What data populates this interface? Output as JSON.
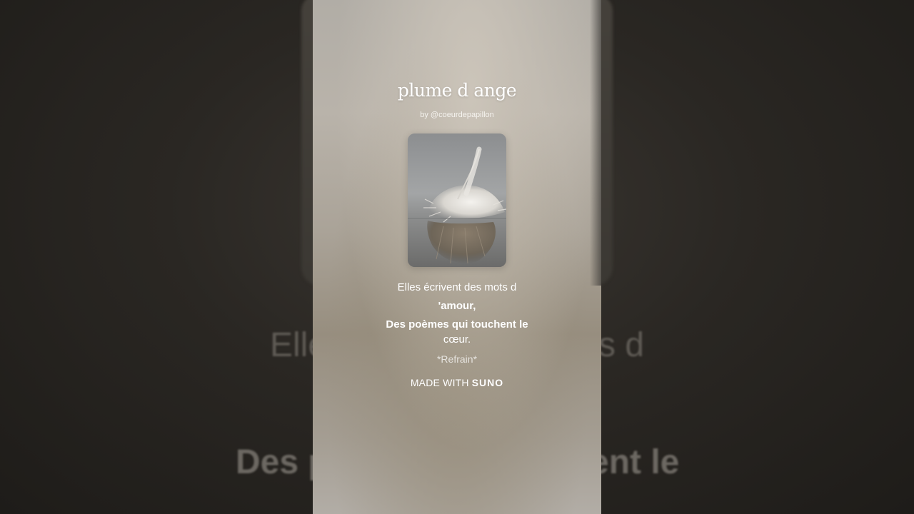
{
  "song": {
    "title": "plume d ange",
    "byline": "by @coeurdepapillon"
  },
  "cover": {
    "icon": "feather-image"
  },
  "lyrics": {
    "lines": [
      "Elles écrivent des mots d",
      "'amour,",
      "Des poèmes qui touchent le",
      "cœur.",
      "*Refrain*"
    ]
  },
  "background_lyrics": {
    "line1_left": "Elle",
    "line1_right": "s d",
    "line2_left": "Des p",
    "line2_right": "ent le"
  },
  "footer": {
    "made_with": "MADE WITH",
    "brand": "SUNO"
  },
  "colors": {
    "panel": "#aaa398",
    "text": "#ffffff",
    "background": "#2a2723"
  }
}
